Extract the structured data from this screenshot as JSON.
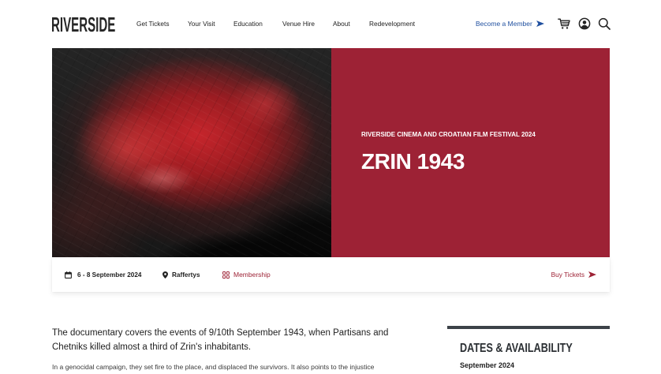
{
  "header": {
    "logo": "RIVERSIDE",
    "nav": [
      "Get Tickets",
      "Your Visit",
      "Education",
      "Venue Hire",
      "About",
      "Redevelopment"
    ],
    "member_link": "Become a Member",
    "icons": {
      "member_arrow": "arrow-right-icon",
      "cart": "cart-icon",
      "account": "account-icon",
      "search": "search-icon"
    }
  },
  "hero": {
    "eyebrow": "RIVERSIDE CINEMA AND CROATIAN FILM FESTIVAL 2024",
    "title": "ZRIN 1943"
  },
  "info_bar": {
    "dates": "6 - 8 September 2024",
    "venue": "Raffertys",
    "membership": "Membership",
    "buy_tickets": "Buy Tickets",
    "icons": {
      "dates": "calendar-icon",
      "venue": "location-pin-icon",
      "membership": "membership-grid-icon",
      "buy": "arrow-right-icon"
    }
  },
  "content": {
    "lead": "The documentary covers the events of 9/10th September 1943, when Partisans and Chetniks killed almost a third of Zrin's inhabitants.",
    "body": "In a genocidal campaign, they set fire to the place, and displaced the survivors. It also points to the injustice"
  },
  "sidebar": {
    "heading": "DATES & AVAILABILITY",
    "month": "September 2024"
  },
  "colors": {
    "accent": "#9d2235",
    "member_link": "#1f4f9f",
    "sidebar_rule": "#3c4248",
    "text": "#1e1e1e"
  }
}
